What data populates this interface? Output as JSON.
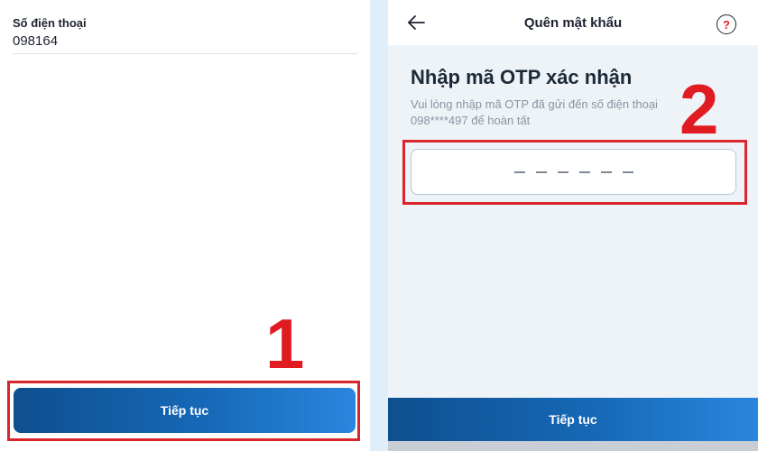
{
  "left_screen": {
    "phone_label": "Số điện thoại",
    "phone_value": "098164",
    "continue_label": "Tiếp tục",
    "step_number": "1"
  },
  "right_screen": {
    "header_title": "Quên mật khẩu",
    "help_glyph": "?",
    "title": "Nhập mã OTP xác nhận",
    "description": "Vui lòng nhập mã OTP đã gửi đến số điện thoại 098****497 để hoàn tất",
    "continue_label": "Tiếp tục",
    "step_number": "2",
    "otp_slots": 6
  },
  "icons": {
    "back": "arrow-left-icon",
    "help": "question-circle-icon"
  },
  "colors": {
    "primary_button": "#1668b6",
    "annotation_red": "#e11b22",
    "divider": "#dfeef9",
    "otp_background": "#eef3f8"
  }
}
